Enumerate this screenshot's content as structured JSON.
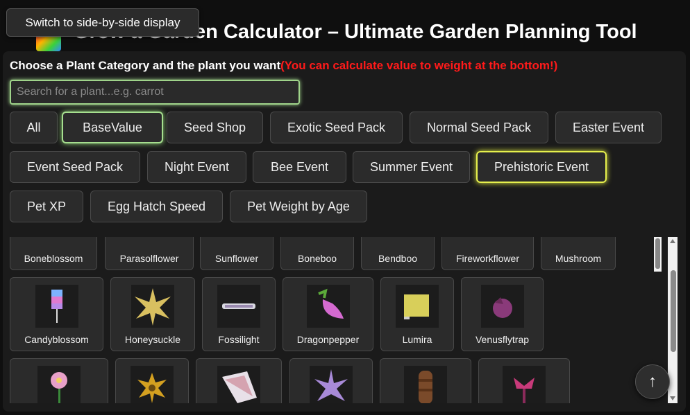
{
  "header": {
    "title": "Grow a Garden Calculator – Ultimate Garden Planning Tool"
  },
  "switch_button": {
    "label": "Switch to side-by-side display"
  },
  "prompt": {
    "main": "Choose a Plant Category and the plant you want",
    "note": "(You can calculate value to weight at the bottom!)"
  },
  "search": {
    "placeholder": "Search for a plant...e.g. carrot",
    "value": ""
  },
  "categories": [
    {
      "label": "All",
      "state": "normal"
    },
    {
      "label": "BaseValue",
      "state": "highlight-green"
    },
    {
      "label": "Seed Shop",
      "state": "normal"
    },
    {
      "label": "Exotic Seed Pack",
      "state": "normal"
    },
    {
      "label": "Normal Seed Pack",
      "state": "normal"
    },
    {
      "label": "Easter Event",
      "state": "normal"
    },
    {
      "label": "Event Seed Pack",
      "state": "normal"
    },
    {
      "label": "Night Event",
      "state": "normal"
    },
    {
      "label": "Bee Event",
      "state": "normal"
    },
    {
      "label": "Summer Event",
      "state": "normal"
    },
    {
      "label": "Prehistoric Event",
      "state": "selected-yellow"
    },
    {
      "label": "Pet XP",
      "state": "normal"
    },
    {
      "label": "Egg Hatch Speed",
      "state": "normal"
    },
    {
      "label": "Pet Weight by Age",
      "state": "normal"
    }
  ],
  "plants": {
    "row1": [
      "Boneblossom",
      "Parasolflower",
      "Sunflower",
      "Boneboo",
      "Bendboo",
      "Fireworkflower",
      "Mushroom"
    ],
    "row2": [
      "Candyblossom",
      "Honeysuckle",
      "Fossilight",
      "Dragonpepper",
      "Lumira",
      "Venusflytrap"
    ],
    "row3": [
      "",
      "",
      "",
      "",
      "",
      ""
    ]
  },
  "back_to_top": {
    "icon": "arrow-up-icon",
    "glyph": "↑"
  }
}
